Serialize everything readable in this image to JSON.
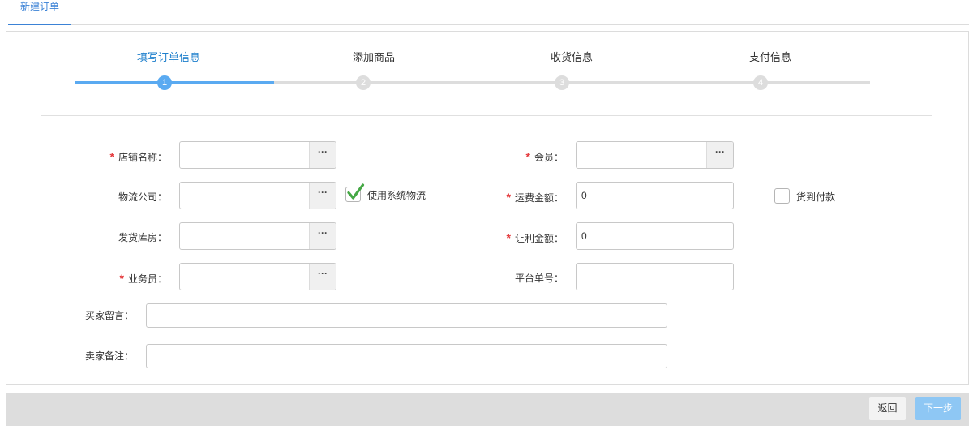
{
  "tab_bar": {
    "tabs": [
      {
        "label": "新建订单",
        "active": true
      }
    ]
  },
  "steps": {
    "progress": 0.25,
    "items": [
      {
        "number": "1",
        "label": "填写订单信息",
        "active": true
      },
      {
        "number": "2",
        "label": "添加商品",
        "active": false
      },
      {
        "number": "3",
        "label": "收货信息",
        "active": false
      },
      {
        "number": "4",
        "label": "支付信息",
        "active": false
      }
    ]
  },
  "form": {
    "required_mark": "*",
    "picker_label": "···",
    "shop": {
      "label": "店铺名称：",
      "required": true,
      "value": ""
    },
    "logistics_company": {
      "label": "物流公司：",
      "required": false,
      "value": ""
    },
    "use_system_logistics": {
      "label": "使用系统物流",
      "checked": true
    },
    "warehouse": {
      "label": "发货库房：",
      "required": false,
      "value": ""
    },
    "salesperson": {
      "label": "业务员：",
      "required": true,
      "value": ""
    },
    "member": {
      "label": "会员：",
      "required": true,
      "value": ""
    },
    "shipping_fee": {
      "label": "运费金额：",
      "required": true,
      "value": "0"
    },
    "cash_on_delivery": {
      "label": "货到付款",
      "checked": false
    },
    "discount_amount": {
      "label": "让利金额：",
      "required": true,
      "value": "0"
    },
    "platform_order_no": {
      "label": "平台单号：",
      "required": false,
      "value": ""
    },
    "buyer_message": {
      "label": "买家留言：",
      "value": ""
    },
    "seller_note": {
      "label": "卖家备注：",
      "value": ""
    }
  },
  "footer": {
    "back_label": "返回",
    "next_label": "下一步"
  },
  "icons": {
    "picker": "ellipsis-icon",
    "check": "checkmark-icon"
  },
  "colors": {
    "accent": "#5aaaf1",
    "active_text": "#1e7fcc",
    "tab_accent": "#3b82d6",
    "required": "#e4393c",
    "check": "#45a845",
    "next_button": "#8ec7f4",
    "inactive": "#dddddd"
  }
}
